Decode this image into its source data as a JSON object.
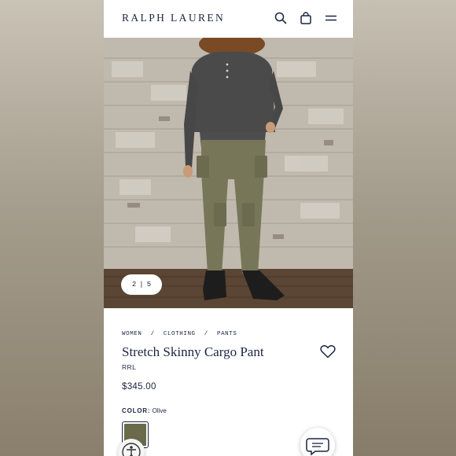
{
  "header": {
    "logo": "RALPH LAUREN",
    "icons": [
      "search-icon",
      "bag-icon",
      "menu-icon"
    ]
  },
  "gallery": {
    "current": "2",
    "total": "5"
  },
  "breadcrumb": [
    "WOMEN",
    "CLOTHING",
    "PANTS"
  ],
  "product": {
    "title": "Stretch Skinny Cargo Pant",
    "brand": "RRL",
    "price": "$345.00",
    "color_label": "COLOR:",
    "color_value": "Olive"
  },
  "colors": {
    "brand_navy": "#1c2541",
    "swatch_olive": "#6b6a4a"
  }
}
